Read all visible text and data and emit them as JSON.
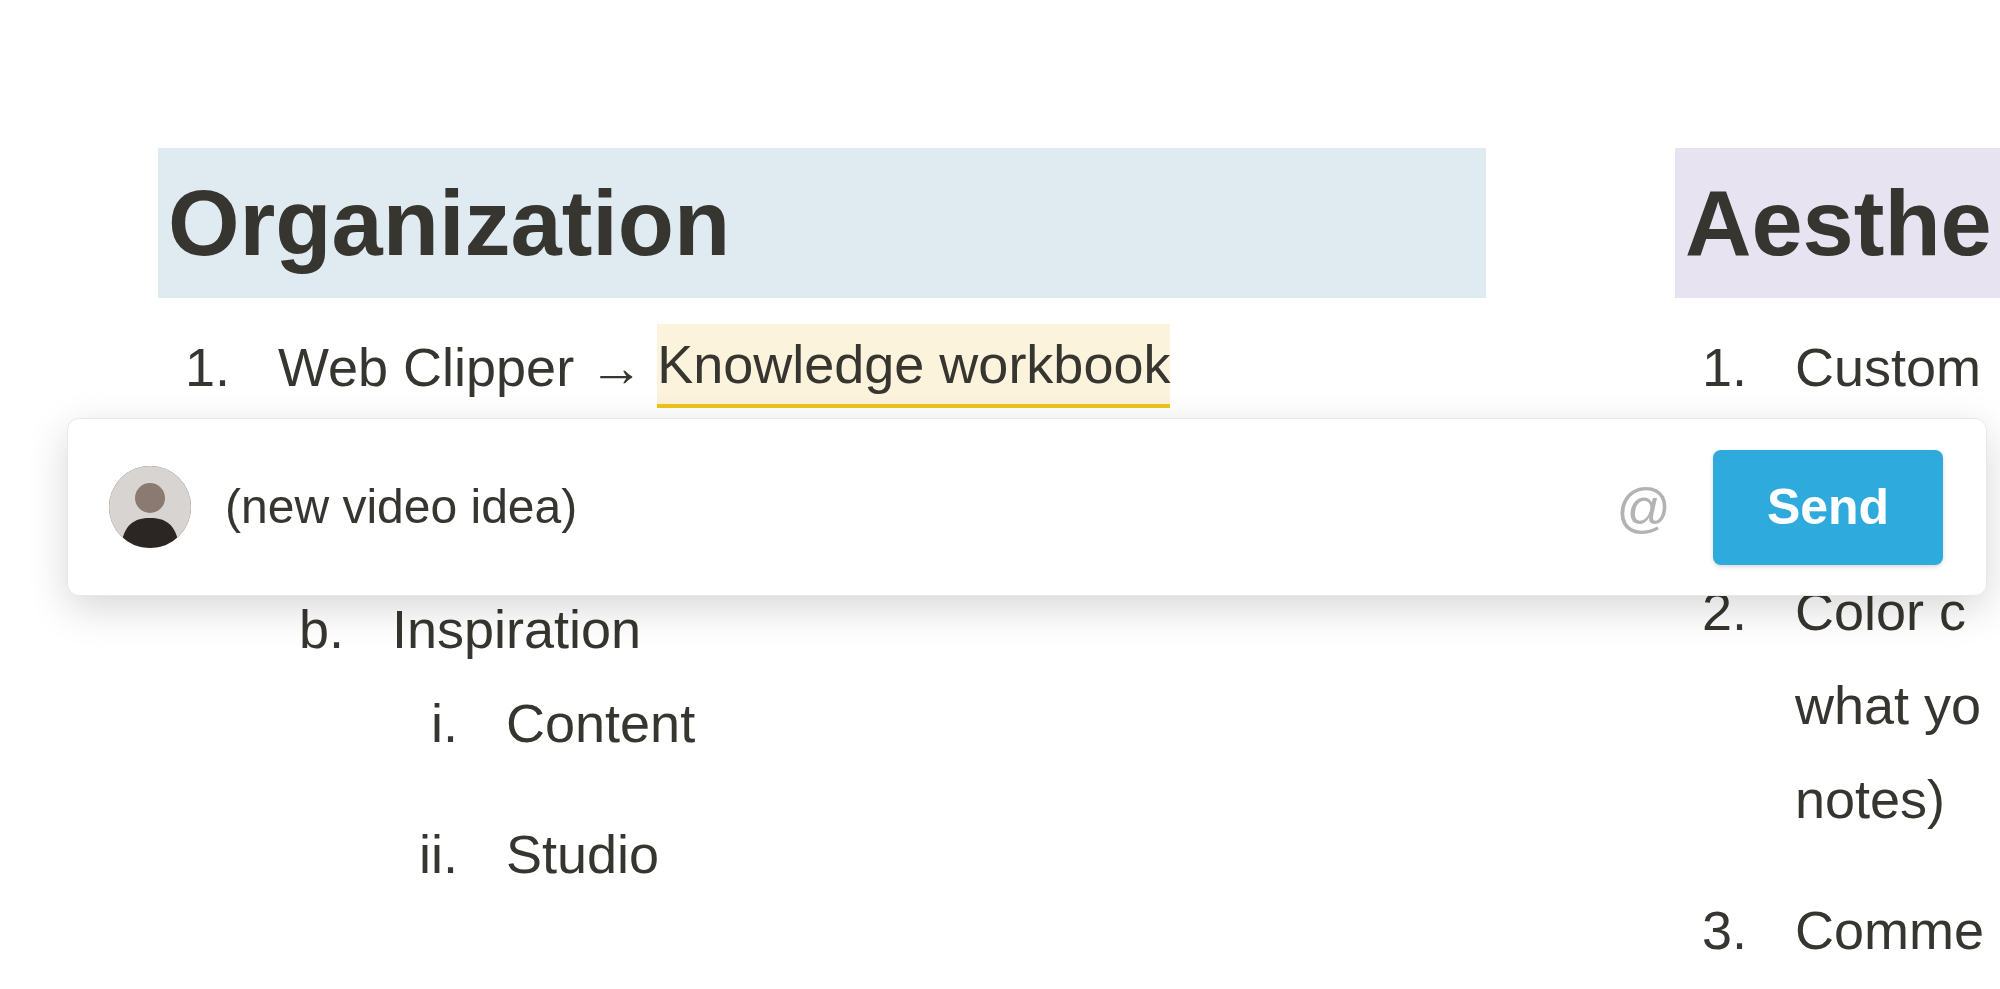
{
  "columns": [
    {
      "heading": "Organization",
      "color": "#dfeaf1",
      "items": [
        {
          "marker": "1.",
          "segments": [
            {
              "text": "Web Clipper →",
              "highlighted": false
            },
            {
              "text": "Knowledge workbook",
              "highlighted": true
            }
          ],
          "children": [
            {
              "marker": "b.",
              "segments": [
                {
                  "text": "Inspiration",
                  "highlighted": false
                }
              ],
              "children": [
                {
                  "marker": "i.",
                  "segments": [
                    {
                      "text": "Content",
                      "highlighted": false
                    }
                  ]
                },
                {
                  "marker": "ii.",
                  "segments": [
                    {
                      "text": "Studio",
                      "highlighted": false
                    }
                  ]
                }
              ]
            }
          ]
        }
      ]
    },
    {
      "heading": "Aesthe",
      "color": "#e7e3f1",
      "items": [
        {
          "marker": "1.",
          "segments": [
            {
              "text": "Custom",
              "highlighted": false
            }
          ]
        },
        {
          "marker": "2.",
          "segments": [
            {
              "text": "Color c",
              "highlighted": false
            }
          ],
          "more_lines": [
            "what yo",
            "notes)"
          ]
        },
        {
          "marker": "3.",
          "segments": [
            {
              "text": "Comme",
              "highlighted": false
            }
          ]
        }
      ]
    }
  ],
  "comment_box": {
    "value": "(new video idea)",
    "mention": "@",
    "send": "Send"
  }
}
